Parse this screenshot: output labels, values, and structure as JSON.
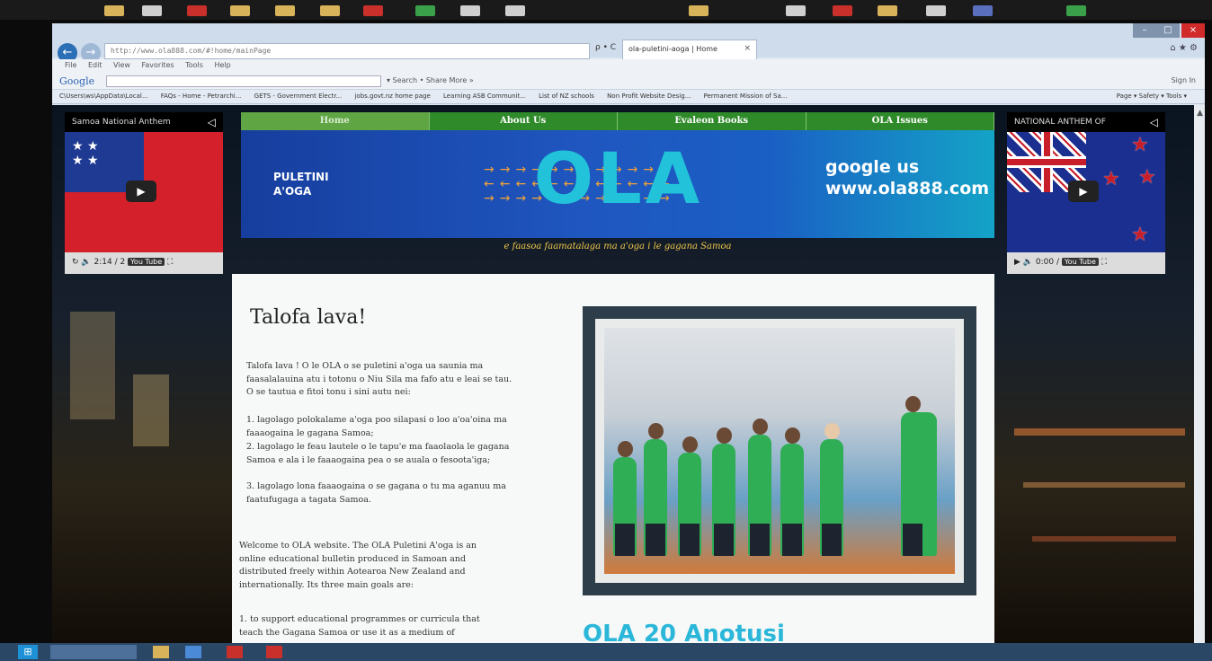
{
  "browser": {
    "address": "http://www.ola888.com/#!home/mainPage",
    "address_tools": "ρ • C",
    "tab_title": "ola-puletini-aoga | Home",
    "tab_close": "×",
    "right_icons": "⌂ ★ ⚙"
  },
  "menu": [
    "File",
    "Edit",
    "View",
    "Favorites",
    "Tools",
    "Help"
  ],
  "google_bar": {
    "label": "Google",
    "tools": "▾  Search •   Share   More »",
    "sign_in": "Sign In"
  },
  "favorites": [
    "C\\Users\\ws\\AppData\\Local...",
    "FAQs - Home - Petrarchi...",
    "GETS - Government Electr...",
    "jobs.govt.nz home page",
    "Learning  ASB Communit...",
    "List of NZ schools",
    "Non Profit Website Desig...",
    "Permanent Mission of Sa..."
  ],
  "command_bar": "Page ▾   Safety ▾   Tools ▾",
  "site": {
    "nav": [
      "Home",
      "About Us",
      "Evaleon Books",
      "OLA Issues"
    ],
    "banner_left": [
      "PULETINI",
      "A'OGA"
    ],
    "banner_logo": "OLA",
    "banner_right": [
      "google us",
      "www.ola888.com"
    ],
    "tagline": "e faasoa faamatalaga ma a'oga i le gagana Samoa",
    "video_left": {
      "title": "Samoa National Anthem",
      "time": "2:14 / 2"
    },
    "video_right": {
      "title": "NATIONAL ANTHEM OF",
      "time": "0:00 / "
    },
    "youtube": "You Tube",
    "content_title": "Talofa lava!",
    "para1": "Talofa lava ! O le OLA o se puletini a'oga ua saunia ma faasalalauina atu i totonu o Niu Sila ma fafo atu e leai se tau. O se tautua e fitoi tonu i sini autu nei:",
    "para2": "1. lagolago polokalame a'oga poo silapasi o loo a'oa'oina ma faaaogaina le gagana Samoa;",
    "para3": "2. lagolago le feau lautele o le tapu'e ma faaolaola le gagana Samoa e ala i le faaaogaina pea o se auala o fesoota'iga;",
    "para4": "3. lagolago lona faaaogaina o se gagana o tu ma aganuu ma faatufugaga a tagata Samoa.",
    "para5": "Welcome to OLA website. The OLA Puletini A'oga is an online educational bulletin produced in Samoan and distributed freely within Aotearoa New Zealand and internationally. Its three main goals are:",
    "para6": "1. to support educational programmes or curricula that teach the Gagana Samoa or use it as a medium of",
    "headline": "OLA 20 Anotusi"
  },
  "colors": {
    "nav_green": "#2f8a2a",
    "banner_blue": "#1f56bf",
    "logo_cyan": "#22c3da",
    "tagline_gold": "#f0c84a"
  }
}
